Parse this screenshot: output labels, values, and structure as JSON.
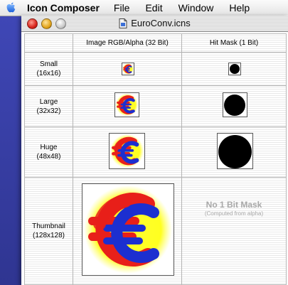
{
  "menubar": {
    "app_name": "Icon Composer",
    "items": [
      "File",
      "Edit",
      "Window",
      "Help"
    ]
  },
  "window": {
    "title": "EuroConv.icns"
  },
  "table": {
    "col_headers": [
      "Image RGB/Alpha (32 Bit)",
      "Hit Mask (1 Bit)"
    ],
    "rows": [
      {
        "name": "Small",
        "size": "(16x16)"
      },
      {
        "name": "Large",
        "size": "(32x32)"
      },
      {
        "name": "Huge",
        "size": "(48x48)"
      },
      {
        "name": "Thumbnail",
        "size": "(128x128)"
      }
    ],
    "no_mask_title": "No 1 Bit Mask",
    "no_mask_subtitle": "(Computed from alpha)"
  },
  "colors": {
    "euro_red": "#e8201a",
    "euro_blue": "#1c2fd0",
    "glow_yellow": "#ffff20",
    "desktop_blue": "#3a40a6"
  }
}
